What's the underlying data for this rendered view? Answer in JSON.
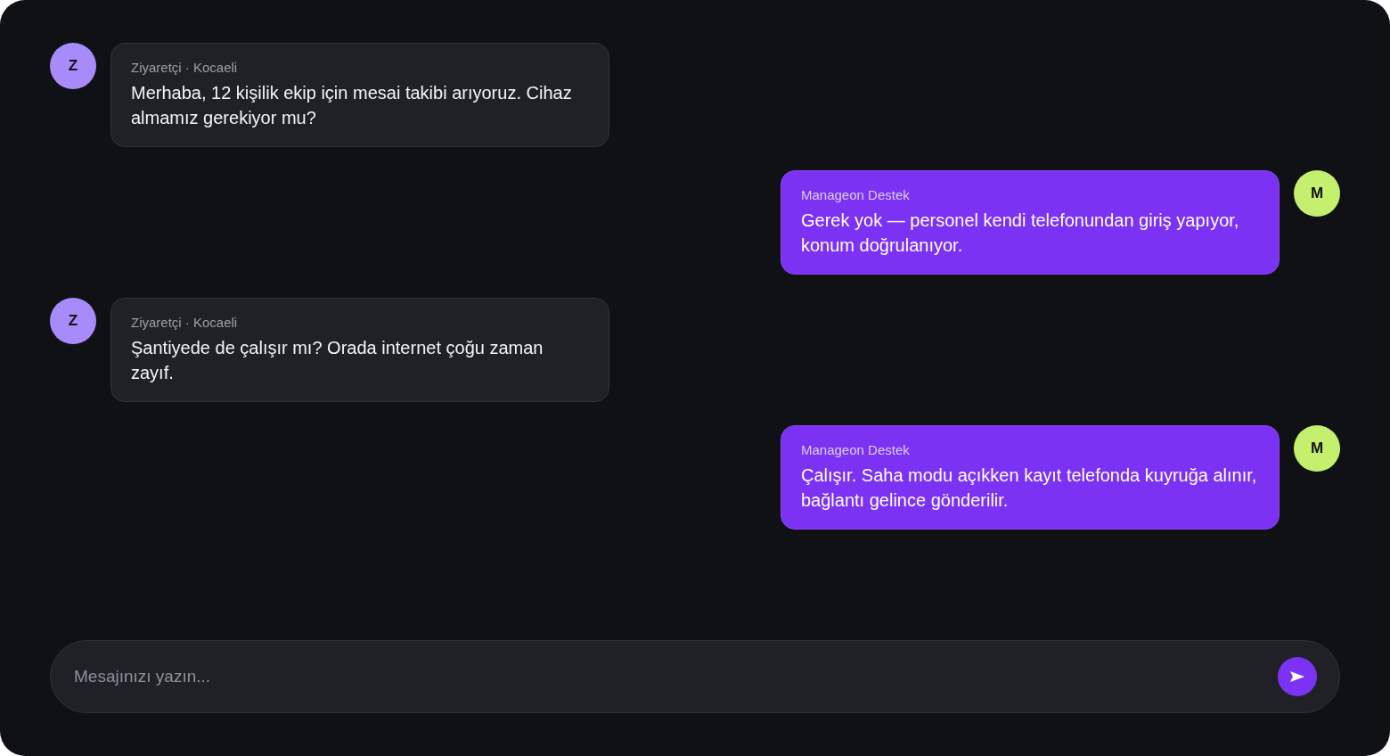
{
  "messages": [
    {
      "kind": "visitor",
      "avatar": "Z",
      "sender": "Ziyaretçi · Kocaeli",
      "text": "Merhaba, 12 kişilik ekip için mesai takibi arıyoruz. Cihaz almamız gerekiyor mu?"
    },
    {
      "kind": "agent",
      "avatar": "M",
      "sender": "Manageon Destek",
      "text": "Gerek yok — personel kendi telefonundan giriş yapıyor, konum doğrulanıyor."
    },
    {
      "kind": "visitor",
      "avatar": "Z",
      "sender": "Ziyaretçi · Kocaeli",
      "text": "Şantiyede de çalışır mı? Orada internet çoğu zaman zayıf."
    },
    {
      "kind": "agent",
      "avatar": "M",
      "sender": "Manageon Destek",
      "text": "Çalışır. Saha modu açıkken kayıt telefonda kuyruğa alınır, bağlantı gelince gönderilir."
    }
  ],
  "composer": {
    "placeholder": "Mesajınızı yazın..."
  }
}
